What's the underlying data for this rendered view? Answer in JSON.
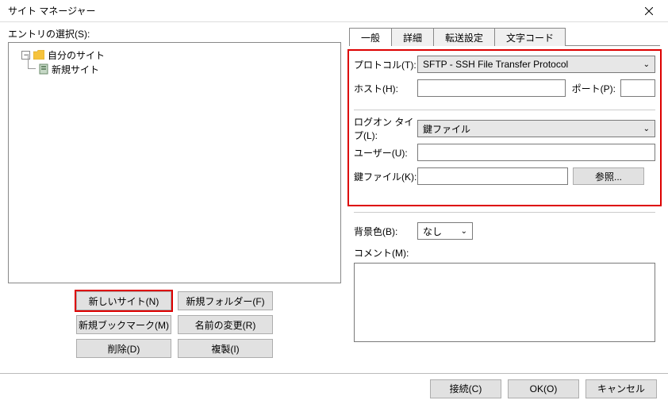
{
  "window": {
    "title": "サイト マネージャー"
  },
  "entry": {
    "label": "エントリの選択(S):"
  },
  "tree": {
    "root": "自分のサイト",
    "newsite": "新規サイト"
  },
  "buttons": {
    "new_site": "新しいサイト(N)",
    "new_folder": "新規フォルダー(F)",
    "new_bookmark": "新規ブックマーク(M)",
    "rename": "名前の変更(R)",
    "delete": "削除(D)",
    "duplicate": "複製(I)"
  },
  "tabs": {
    "general": "一般",
    "detail": "詳細",
    "transfer": "転送設定",
    "charset": "文字コード"
  },
  "form": {
    "protocol_label": "プロトコル(T):",
    "protocol_value": "SFTP - SSH File Transfer Protocol",
    "host_label": "ホスト(H):",
    "port_label": "ポート(P):",
    "logon_label": "ログオン タイプ(L):",
    "logon_value": "鍵ファイル",
    "user_label": "ユーザー(U):",
    "keyfile_label": "鍵ファイル(K):",
    "browse": "参照...",
    "bgcolor_label": "背景色(B):",
    "bgcolor_value": "なし",
    "comment_label": "コメント(M):"
  },
  "footer": {
    "connect": "接続(C)",
    "ok": "OK(O)",
    "cancel": "キャンセル"
  }
}
